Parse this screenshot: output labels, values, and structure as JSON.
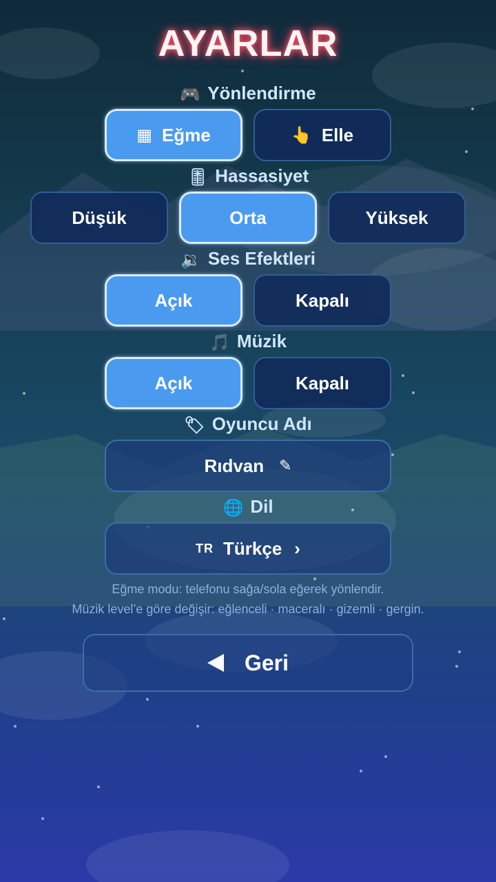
{
  "title": "AYARLAR",
  "sections": {
    "orientation": {
      "icon": "🎮",
      "label": "Yönlendirme",
      "options": [
        {
          "icon": "▦",
          "label": "Eğme",
          "active": true
        },
        {
          "icon": "👆",
          "label": "Elle",
          "active": false
        }
      ]
    },
    "sensitivity": {
      "icon": "🎚",
      "label": "Hassasiyet",
      "options": [
        {
          "label": "Düşük",
          "active": false
        },
        {
          "label": "Orta",
          "active": true
        },
        {
          "label": "Yüksek",
          "active": false
        }
      ]
    },
    "sound": {
      "icon": "🔉",
      "label": "Ses Efektleri",
      "options": [
        {
          "label": "Açık",
          "active": true
        },
        {
          "label": "Kapalı",
          "active": false
        }
      ]
    },
    "music": {
      "icon": "🎵",
      "label": "Müzik",
      "options": [
        {
          "label": "Açık",
          "active": true
        },
        {
          "label": "Kapalı",
          "active": false
        }
      ]
    },
    "player": {
      "icon": "🏷",
      "label": "Oyuncu Adı",
      "value": "Rıdvan",
      "edit_icon": "✎"
    },
    "language": {
      "icon": "🌐",
      "label": "Dil",
      "code": "TR",
      "value": "Türkçe",
      "chevron": "›"
    }
  },
  "hints": [
    "Eğme modu: telefonu sağa/sola eğerek yönlendir.",
    "Müzik level’e göre değişir: eğlenceli · maceralı · gizemli · gergin."
  ],
  "back_label": "Geri",
  "colors": {
    "active": "#4a9af0",
    "inactive": "#102a5a",
    "title_glow": "#ff3b56",
    "label": "#cfe6ff"
  }
}
